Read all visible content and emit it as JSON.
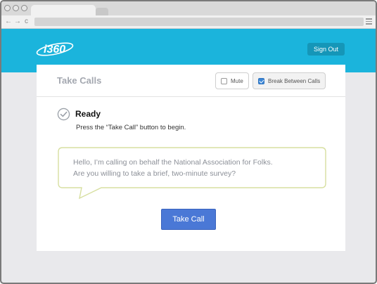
{
  "browser": {
    "back_glyph": "←",
    "forward_glyph": "→",
    "reload_glyph": "c"
  },
  "header": {
    "logo_text": "i360",
    "signout_label": "Sign Out"
  },
  "card": {
    "title": "Take Calls",
    "mute_label": "Mute",
    "mute_checked": false,
    "break_label": "Break Between Calls",
    "break_checked": true
  },
  "status": {
    "title": "Ready",
    "instruction": "Press the “Take Call” button to begin."
  },
  "script": {
    "line1": "Hello, I’m calling on behalf the National Association for Folks.",
    "line2": "Are you willing to take a brief, two-minute survey?"
  },
  "actions": {
    "take_call_label": "Take Call"
  },
  "colors": {
    "header_bg": "#1bb4dc",
    "signout_bg": "#1596b8",
    "primary_button": "#4a78d6",
    "bubble_border": "#d7dfa0"
  },
  "icons": [
    "menu-icon",
    "check-circle-icon",
    "checkbox-icon",
    "logo-icon"
  ]
}
